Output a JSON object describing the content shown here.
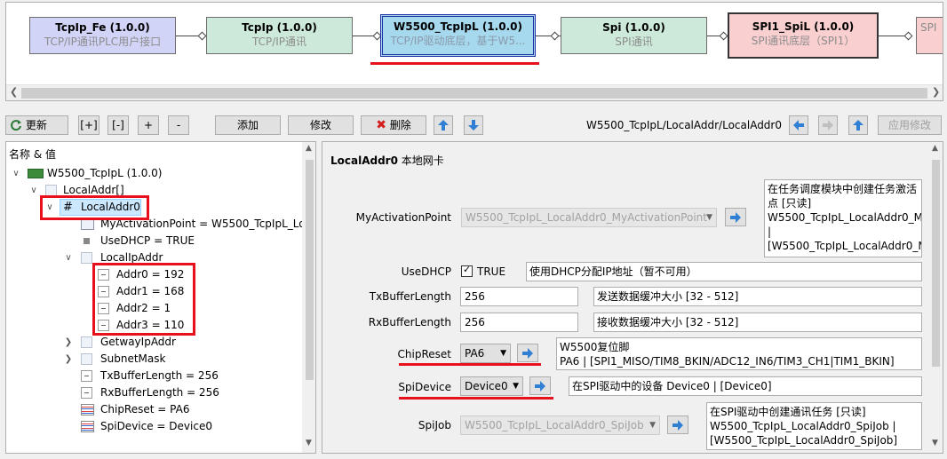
{
  "modules": [
    {
      "name": "TcpIp_Fe (1.0.0)",
      "desc": "TCP/IP通讯PLC用户接口"
    },
    {
      "name": "TcpIp (1.0.0)",
      "desc": "TCP/IP通讯"
    },
    {
      "name": "W5500_TcpIpL (1.0.0)",
      "desc": "TCP/IP驱动底层，基于W5..."
    },
    {
      "name": "Spi (1.0.0)",
      "desc": "SPI通讯"
    },
    {
      "name": "SPI1_SpiL (1.0.0)",
      "desc": "SPI通讯底层（SPI1）"
    },
    {
      "name": "",
      "desc": "SPI"
    }
  ],
  "toolbar": {
    "refresh": "更新",
    "expand": "[+]",
    "collapse": "[-]",
    "plus": "+",
    "minus": "-",
    "add": "添加",
    "modify": "修改",
    "delete": "删除",
    "path": "W5500_TcpIpL/LocalAddr/LocalAddr0",
    "apply": "应用修改"
  },
  "tree": {
    "header": "名称 & 值",
    "rows": [
      {
        "text": "W5500_TcpIpL (1.0.0)"
      },
      {
        "text": "LocalAddr[]"
      },
      {
        "text": "LocalAddr0"
      },
      {
        "text": "MyActivationPoint = W5500_TcpIpL_Loc"
      },
      {
        "text": "UseDHCP = TRUE"
      },
      {
        "text": "LocalIpAddr"
      },
      {
        "text": "Addr0 = 192"
      },
      {
        "text": "Addr1 = 168"
      },
      {
        "text": "Addr2 = 1"
      },
      {
        "text": "Addr3 = 110"
      },
      {
        "text": "GetwayIpAddr"
      },
      {
        "text": "SubnetMask"
      },
      {
        "text": "TxBufferLength = 256"
      },
      {
        "text": "RxBufferLength = 256"
      },
      {
        "text": "ChipReset = PA6"
      },
      {
        "text": "SpiDevice = Device0"
      }
    ]
  },
  "panel": {
    "title": "LocalAddr0",
    "subtitle": "本地网卡",
    "my_activation_point": {
      "label": "MyActivationPoint",
      "value": "W5500_TcpIpL_LocalAddr0_MyActivationPoint",
      "note": "在任务调度模块中创建任务激活\n点 [只读]\nW5500_TcpIpL_LocalAddr0_M\n|\n[W5500_TcpIpL_LocalAddr0_M"
    },
    "use_dhcp": {
      "label": "UseDHCP",
      "value": "TRUE",
      "checked": true,
      "note": "使用DHCP分配IP地址（暂不可用）"
    },
    "tx_buffer": {
      "label": "TxBufferLength",
      "value": "256",
      "note": "发送数据缓冲大小 [32 - 512]"
    },
    "rx_buffer": {
      "label": "RxBufferLength",
      "value": "256",
      "note": "接收数据缓冲大小 [32 - 512]"
    },
    "chip_reset": {
      "label": "ChipReset",
      "value": "PA6",
      "note": "W5500复位脚\nPA6 | [SPI1_MISO/TIM8_BKIN/ADC12_IN6/TIM3_CH1|TIM1_BKIN]"
    },
    "spi_device": {
      "label": "SpiDevice",
      "value": "Device0",
      "note": "在SPI驱动中的设备 Device0 | [Device0]"
    },
    "spi_job": {
      "label": "SpiJob",
      "value": "W5500_TcpIpL_LocalAddr0_SpiJob",
      "note": "在SPI驱动中创建通讯任务 [只读]\nW5500_TcpIpL_LocalAddr0_SpiJob |\n[W5500_TcpIpL_LocalAddr0_SpiJob]"
    }
  },
  "colors": {
    "highlight": "#e8101c",
    "selected_module": "#a6d8ee",
    "selection": "#cce8ff"
  }
}
